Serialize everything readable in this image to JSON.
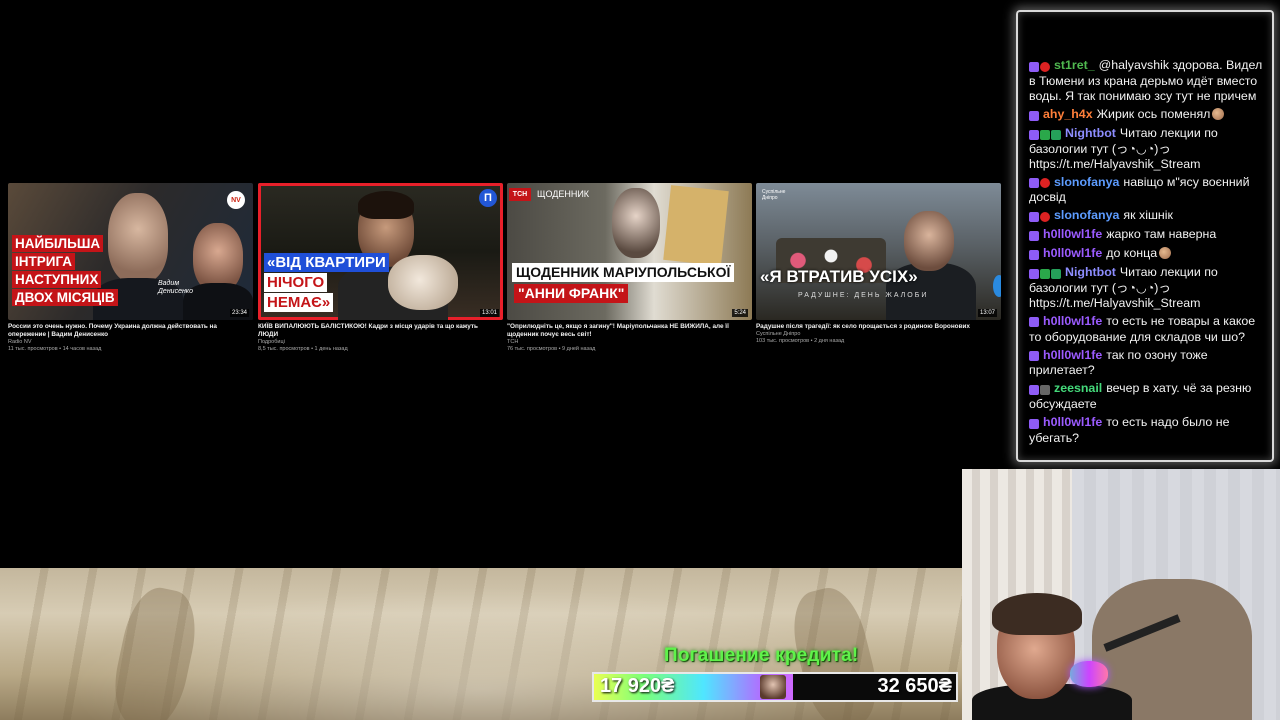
{
  "videos": [
    {
      "thumb_text": [
        "НАЙБІЛЬША",
        "ІНТРИГА",
        "НАСТУПНИХ",
        "ДВОХ МІСЯЦІВ"
      ],
      "signature": "Вадим\nДенисенко",
      "badge": "NV",
      "duration": "23:34",
      "title": "России это очень нужно. Почему Украина должна действовать на опережение | Вадим Денисенко",
      "channel": "Radio NV",
      "meta": "11 тыс. просмотров • 14 часов назад"
    },
    {
      "thumb_text": [
        "«ВІД КВАРТИРИ",
        "НІЧОГО",
        "НЕМАЄ»"
      ],
      "badge": "П",
      "duration": "13:01",
      "title": "КИЇВ ВИПАЛЮЮТЬ БАЛІСТИКОЮ! Кадри з місця ударів та що кажуть ЛЮДИ",
      "channel": "Подробиці",
      "meta": "8,5 тыс. просмотров • 1 день назад"
    },
    {
      "thumb_text": [
        "ЩОДЕННИК МАРІУПОЛЬСЬКОЇ",
        "\"АННИ ФРАНК\""
      ],
      "badge": "ТСН",
      "diary_label": "ЩОДЕННИК",
      "duration": "5:24",
      "title": "\"Оприлюдніть це, якщо я загину\"! Маріупольчанка НЕ ВИЖИЛА, але її щоденник почує весь світ!",
      "channel": "ТСН",
      "meta": "76 тыс. просмотров • 9 дней назад"
    },
    {
      "thumb_text": [
        "«Я ВТРАТИВ УСІХ»"
      ],
      "subtitle": "РАДУШНЕ: ДЕНЬ ЖАЛОБИ",
      "badge": "Суспільне\nДніпро",
      "duration": "13:07",
      "title": "Радушне після трагедії: як село прощається з родиною Воронових",
      "channel": "Суспільне Дніпро",
      "meta": "103 тыс. просмотров • 2 дня назад"
    }
  ],
  "chat": [
    {
      "user": "st1ret_",
      "color": "#4fb84f",
      "badges": [
        "tw",
        "red"
      ],
      "text": "@halyavshik здорова. Видел в Тюмени из крана дерьмо идёт вместо воды. Я так понимаю зсу тут не причем",
      "cut": true
    },
    {
      "user": "ahy_h4x",
      "color": "#ff7f3a",
      "badges": [
        "tw"
      ],
      "text": "Жирик ось поменял",
      "emoji": true
    },
    {
      "user": "Nightbot",
      "color": "#8d8dff",
      "badges": [
        "tw",
        "green",
        "robot"
      ],
      "text": "Читаю лекции по базологии тут (っ◔◡◔)っ https://t.me/Halyavshik_Stream"
    },
    {
      "user": "slonofanya",
      "color": "#5d9cff",
      "badges": [
        "tw",
        "red"
      ],
      "text": "навіщо м\"ясу воєнний досвід"
    },
    {
      "user": "slonofanya",
      "color": "#5d9cff",
      "badges": [
        "tw",
        "red"
      ],
      "text": "як хішнік"
    },
    {
      "user": "h0ll0wl1fe",
      "color": "#9b5bff",
      "badges": [
        "tw"
      ],
      "text": "жарко там наверна"
    },
    {
      "user": "h0ll0wl1fe",
      "color": "#9b5bff",
      "badges": [
        "tw"
      ],
      "text": "до конца",
      "emoji": true
    },
    {
      "user": "Nightbot",
      "color": "#8d8dff",
      "badges": [
        "tw",
        "green",
        "robot"
      ],
      "text": "Читаю лекции по базологии тут (っ◔◡◔)っ https://t.me/Halyavshik_Stream"
    },
    {
      "user": "h0ll0wl1fe",
      "color": "#9b5bff",
      "badges": [
        "tw"
      ],
      "text": "то есть не товары а какое то оборудование для складов чи шо?"
    },
    {
      "user": "h0ll0wl1fe",
      "color": "#9b5bff",
      "badges": [
        "tw"
      ],
      "text": "так по озону тоже прилетает?"
    },
    {
      "user": "zeesnail",
      "color": "#44d97a",
      "badges": [
        "tw",
        "sec"
      ],
      "text": "вечер в хату. чё за резню обсуждаете"
    },
    {
      "user": "h0ll0wl1fe",
      "color": "#9b5bff",
      "badges": [
        "tw"
      ],
      "text": "то есть надо было не убегать?"
    }
  ],
  "goal": {
    "title": "Погашение кредита!",
    "current": "17 920₴",
    "target": "32 650₴",
    "progress": 0.55
  },
  "colors": {
    "accent_red": "#c41418",
    "goal_green": "#5ff24a"
  }
}
